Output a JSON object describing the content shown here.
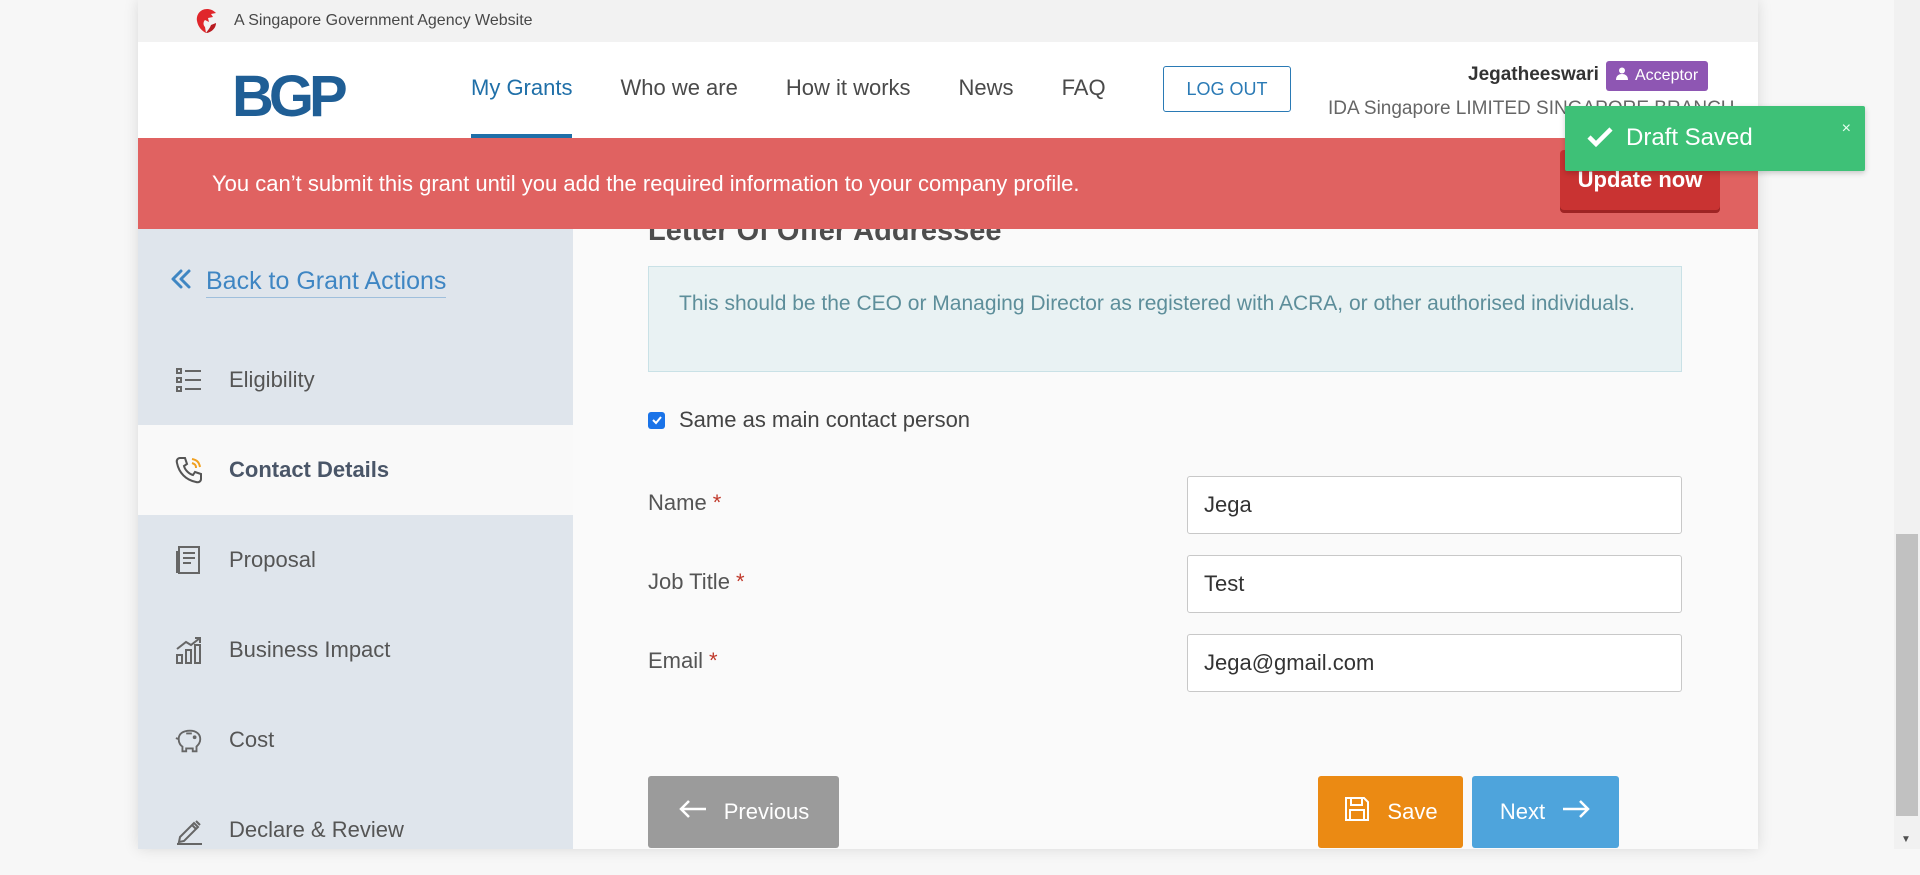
{
  "gov_bar": {
    "text": "A Singapore Government Agency Website",
    "icon": "lion-head-icon"
  },
  "header": {
    "logo": "BGP",
    "nav": [
      {
        "label": "My Grants",
        "active": true
      },
      {
        "label": "Who we are",
        "active": false
      },
      {
        "label": "How it works",
        "active": false
      },
      {
        "label": "News",
        "active": false
      },
      {
        "label": "FAQ",
        "active": false
      }
    ],
    "logout_label": "LOG OUT",
    "user_name": "Jegatheeswari",
    "role": "Acceptor",
    "company": "IDA Singapore LIMITED SINGAPORE BRANCH"
  },
  "alert": {
    "message": "You can’t submit this grant until you add the required information to your company profile.",
    "button_label": "Update now"
  },
  "sidebar": {
    "back_label": "Back to Grant Actions",
    "items": [
      {
        "label": "Eligibility",
        "icon": "list-icon",
        "active": false
      },
      {
        "label": "Contact Details",
        "icon": "phone-icon",
        "active": true
      },
      {
        "label": "Proposal",
        "icon": "document-icon",
        "active": false
      },
      {
        "label": "Business Impact",
        "icon": "bar-chart-icon",
        "active": false
      },
      {
        "label": "Cost",
        "icon": "piggy-bank-icon",
        "active": false
      },
      {
        "label": "Declare & Review",
        "icon": "pen-icon",
        "active": false
      }
    ]
  },
  "main": {
    "section_title": "Letter Of Offer Addressee",
    "info_text": "This should be the CEO or Managing Director as registered with ACRA, or other authorised individuals.",
    "checkbox_label": "Same as main contact person",
    "checkbox_checked": true,
    "fields": [
      {
        "label": "Name",
        "required_mark": "*",
        "value": "Jega"
      },
      {
        "label": "Job Title",
        "required_mark": "*",
        "value": "Test"
      },
      {
        "label": "Email",
        "required_mark": "*",
        "value": "Jega@gmail.com"
      }
    ],
    "buttons": {
      "previous": "Previous",
      "save": "Save",
      "next": "Next"
    }
  },
  "toast": {
    "message": "Draft Saved",
    "close": "×"
  },
  "colors": {
    "brand_blue": "#1f6fa8",
    "alert_red": "#e06261",
    "update_red": "#c93332",
    "toast_green": "#3ec177",
    "save_orange": "#eb8a13",
    "next_blue": "#4ea4dc",
    "role_purple": "#8e56b3"
  }
}
